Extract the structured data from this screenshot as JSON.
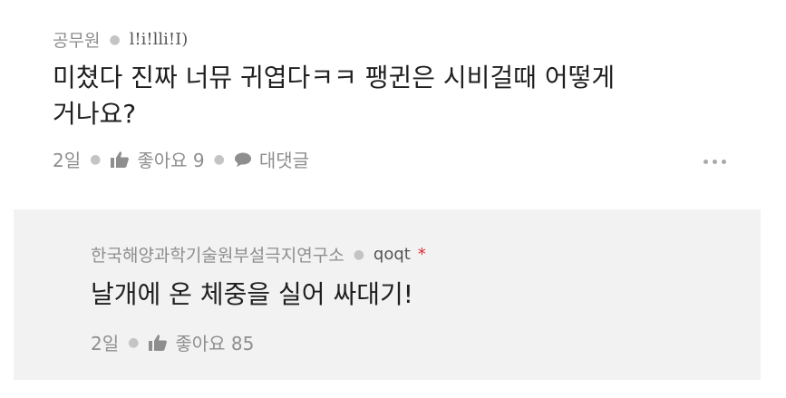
{
  "comment": {
    "author": "공무원",
    "nickname": "l!i!lli!I)",
    "text_line1": "미쳤다 진짜 너뮤 귀엽다ㅋㅋ 팽귄은 시비걸때 어떻게",
    "text_line2": "거나요?",
    "time": "2일",
    "like_label": "좋아요 9",
    "reply_label": "대댓글"
  },
  "reply": {
    "author": "한국해양과학기술원부설극지연구소",
    "nickname": "qoqt",
    "badge": "*",
    "text": "날개에 온 체중을 실어 싸대기!",
    "time": "2일",
    "like_label": "좋아요 85"
  },
  "icons": {
    "like": "thumbs-up-icon",
    "reply": "speech-bubble-icon",
    "more": "more-dots-icon"
  },
  "colors": {
    "meta_gray": "#8e8e8e",
    "text_dark": "#1f1f1f",
    "reply_bg": "#f2f2f2",
    "badge_red": "#e0293a"
  }
}
